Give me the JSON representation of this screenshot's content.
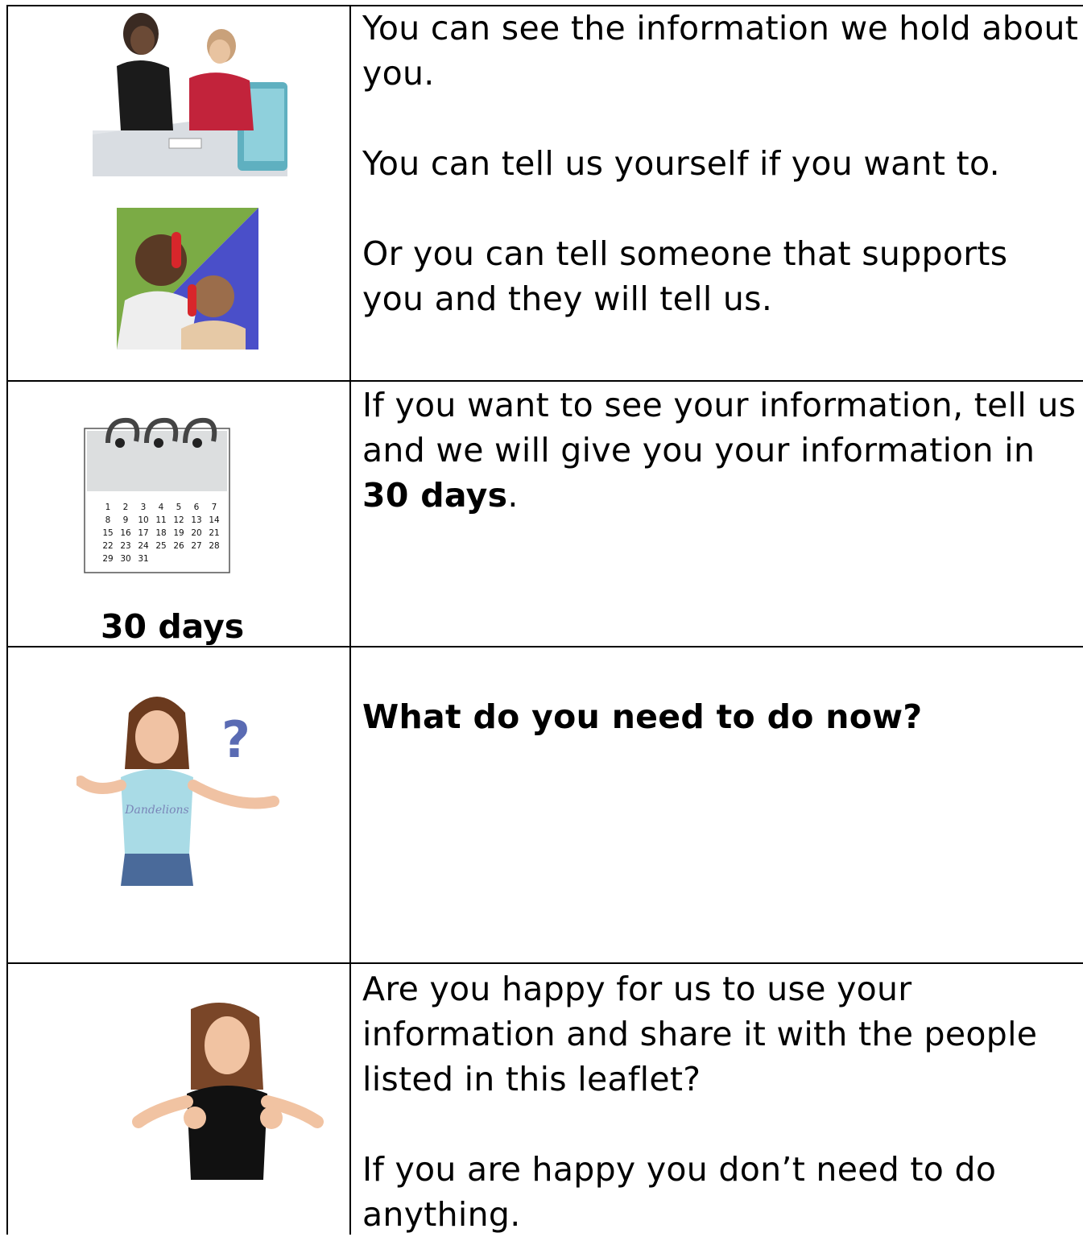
{
  "rows": [
    {
      "paragraphs": [
        "You can see the information we hold about you.",
        "You can tell us yourself if you want to.",
        "Or you can tell someone that supports you and they will tell us."
      ]
    },
    {
      "text_prefix": "If you want to see your information, tell us and we will give you your information in ",
      "text_bold": "30 days",
      "text_suffix": ".",
      "image_label": "30 days",
      "calendar": {
        "weeks": [
          [
            "1",
            "2",
            "3",
            "4",
            "5",
            "6",
            "7"
          ],
          [
            "8",
            "9",
            "10",
            "11",
            "12",
            "13",
            "14"
          ],
          [
            "15",
            "16",
            "17",
            "18",
            "19",
            "20",
            "21"
          ],
          [
            "22",
            "23",
            "24",
            "25",
            "26",
            "27",
            "28"
          ],
          [
            "29",
            "30",
            "31"
          ]
        ]
      }
    },
    {
      "heading": "What do you need to do now?",
      "question_mark": "?",
      "shirt_text": "Dandelions"
    },
    {
      "paragraphs": [
        "Are you happy for us to use your information and share it with the people listed in this leaflet?",
        "If you are happy you don’t need to do anything."
      ]
    }
  ],
  "colors": {
    "question_mark": "#5a6bb3",
    "phone_red": "#d8262b",
    "call_green": "#7bab45",
    "call_blue": "#4a4fc9"
  }
}
